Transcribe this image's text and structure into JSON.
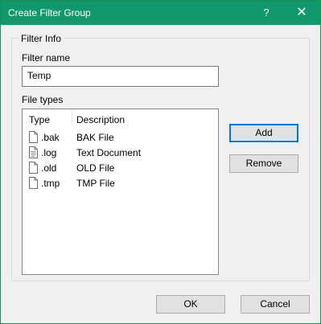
{
  "window": {
    "title": "Create Filter Group",
    "help_glyph": "?",
    "close_glyph": "✕"
  },
  "filter_info": {
    "group_label": "Filter Info",
    "filter_name_label": "Filter name",
    "filter_name_value": "Temp",
    "file_types_label": "File types",
    "columns": {
      "type": "Type",
      "description": "Description"
    },
    "rows": [
      {
        "ext": ".bak",
        "desc": "BAK File",
        "icon": "blank-file-icon"
      },
      {
        "ext": ".log",
        "desc": "Text Document",
        "icon": "text-file-icon"
      },
      {
        "ext": ".old",
        "desc": "OLD File",
        "icon": "blank-file-icon"
      },
      {
        "ext": ".tmp",
        "desc": "TMP File",
        "icon": "blank-file-icon"
      }
    ]
  },
  "buttons": {
    "add": "Add",
    "remove": "Remove",
    "ok": "OK",
    "cancel": "Cancel"
  },
  "colors": {
    "titlebar": "#11996b",
    "focus": "#0078d7"
  }
}
